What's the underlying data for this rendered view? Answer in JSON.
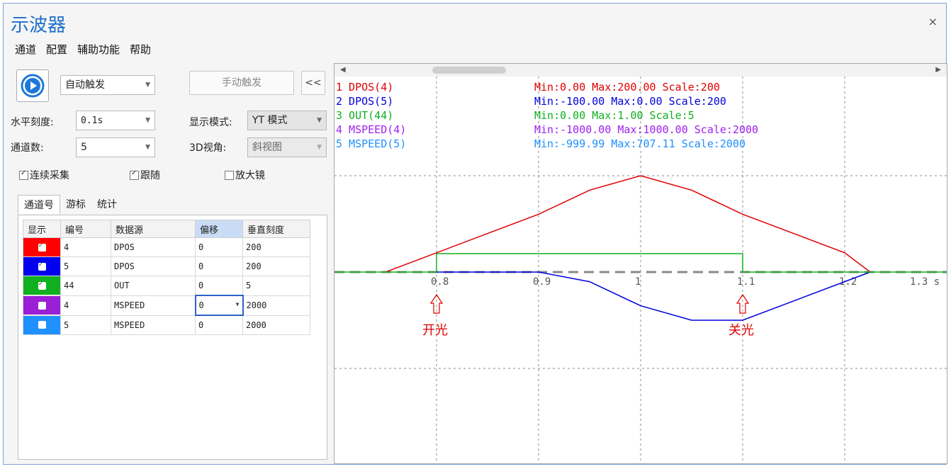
{
  "window": {
    "title": "示波器",
    "close": "×"
  },
  "menu": [
    "通道",
    "配置",
    "辅助功能",
    "帮助"
  ],
  "controls": {
    "trigger_mode": "自动触发",
    "manual_trigger": "手动触发",
    "collapse": "<<",
    "h_scale_label": "水平刻度:",
    "h_scale": "0.1s",
    "display_mode_label": "显示模式:",
    "display_mode": "YT 模式",
    "channels_label": "通道数:",
    "channels": "5",
    "view3d_label": "3D视角:",
    "view3d": "斜视图",
    "continuous": "连续采集",
    "follow": "跟随",
    "magnifier": "放大镜",
    "continuous_checked": true,
    "follow_checked": true,
    "magnifier_checked": false
  },
  "tabs": [
    "通道号",
    "游标",
    "统计"
  ],
  "table": {
    "headers": [
      "显示",
      "编号",
      "数据源",
      "偏移",
      "垂直刻度"
    ],
    "rows": [
      {
        "color": "#ff0000",
        "checked": true,
        "id": "4",
        "source": "DPOS",
        "offset": "0",
        "scale": "200"
      },
      {
        "color": "#0000ee",
        "checked": true,
        "id": "5",
        "source": "DPOS",
        "offset": "0",
        "scale": "200"
      },
      {
        "color": "#10b020",
        "checked": true,
        "id": "44",
        "source": "OUT",
        "offset": "0",
        "scale": "5"
      },
      {
        "color": "#9a1fd6",
        "checked": false,
        "id": "4",
        "source": "MSPEED",
        "offset": "0",
        "scale": "2000"
      },
      {
        "color": "#1e90ff",
        "checked": false,
        "id": "5",
        "source": "MSPEED",
        "offset": "0",
        "scale": "2000"
      }
    ]
  },
  "scope": {
    "legend": [
      {
        "label": "1 DPOS(4)",
        "stats": "Min:0.00  Max:200.00  Scale:200",
        "color": "#e00000"
      },
      {
        "label": "2 DPOS(5)",
        "stats": "Min:-100.00  Max:0.00  Scale:200",
        "color": "#0000dd"
      },
      {
        "label": "3 OUT(44)",
        "stats": "Min:0.00  Max:1.00  Scale:5",
        "color": "#10b020"
      },
      {
        "label": "4 MSPEED(4)",
        "stats": "Min:-1000.00  Max:1000.00  Scale:2000",
        "color": "#a020f0"
      },
      {
        "label": "5 MSPEED(5)",
        "stats": "Min:-999.99  Max:707.11  Scale:2000",
        "color": "#1e90ff"
      }
    ],
    "x_ticks": [
      "0.8",
      "0.9",
      "1",
      "1.1",
      "1.2",
      "1.3 s"
    ],
    "annotations": [
      {
        "text": "开光",
        "color": "#e00000"
      },
      {
        "text": "关光",
        "color": "#e00000"
      }
    ]
  },
  "chart_data": {
    "type": "line",
    "xlim": [
      0.7,
      1.3
    ],
    "x_unit": "s",
    "series": [
      {
        "name": "1 DPOS(4)",
        "color": "#e00000",
        "x": [
          0.75,
          0.8,
          0.85,
          0.9,
          0.95,
          1.0,
          1.05,
          1.1,
          1.15,
          1.2,
          1.225
        ],
        "y": [
          0,
          40,
          80,
          120,
          170,
          200,
          170,
          120,
          80,
          40,
          0
        ]
      },
      {
        "name": "2 DPOS(5)",
        "color": "#0000dd",
        "x": [
          0.8,
          0.9,
          0.95,
          1.0,
          1.05,
          1.1,
          1.15,
          1.225
        ],
        "y": [
          0,
          0,
          -20,
          -70,
          -100,
          -100,
          -60,
          0
        ]
      },
      {
        "name": "3 OUT(44)",
        "color": "#10b020",
        "x": [
          0.7,
          0.8,
          0.8,
          1.1,
          1.1,
          1.3
        ],
        "y": [
          0,
          0,
          1,
          1,
          0,
          0
        ]
      }
    ]
  }
}
